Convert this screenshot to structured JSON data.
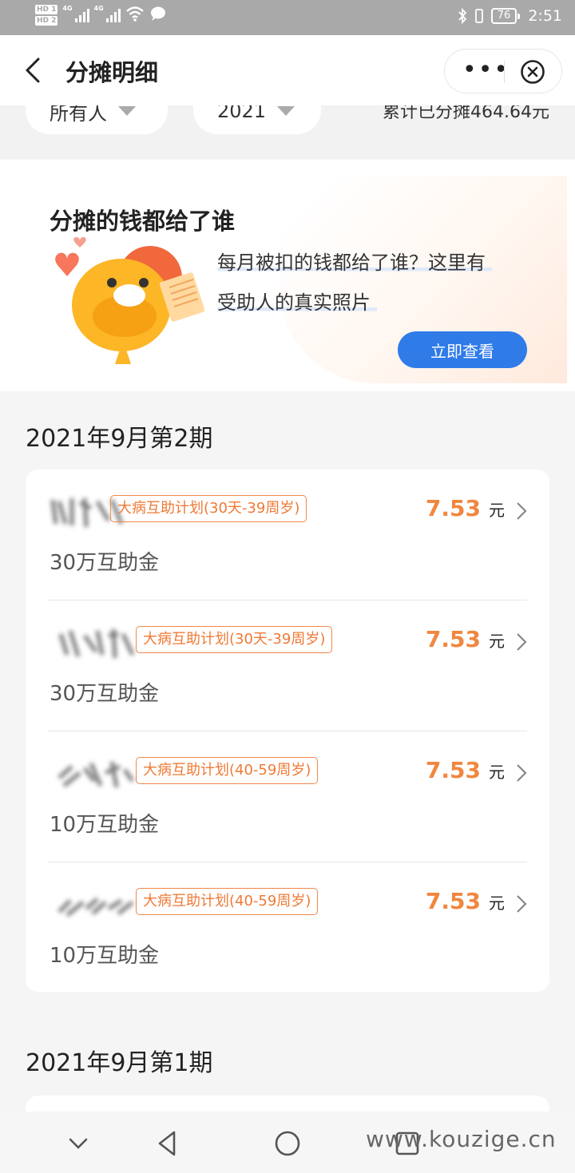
{
  "status_bar": {
    "hd1": "HD 1",
    "hd2": "HD 2",
    "net1": "4G",
    "net2": "4G",
    "battery": "76",
    "time": "2:51"
  },
  "header": {
    "title": "分摊明细",
    "more_label": "•••"
  },
  "filters": {
    "person": "所有人",
    "year": "2021",
    "total": "累计已分摊464.64元"
  },
  "banner": {
    "title": "分摊的钱都给了谁",
    "line1": "每月被扣的钱都给了谁？这里有",
    "line2": "受助人的真实照片",
    "button": "立即查看"
  },
  "periods": [
    {
      "title": "2021年9月第2期",
      "items": [
        {
          "plan": "大病互助计划(30天-39周岁)",
          "amount": "7.53",
          "unit": "元",
          "sub": "30万互助金"
        },
        {
          "plan": "大病互助计划(30天-39周岁)",
          "amount": "7.53",
          "unit": "元",
          "sub": "30万互助金"
        },
        {
          "plan": "大病互助计划(40-59周岁)",
          "amount": "7.53",
          "unit": "元",
          "sub": "10万互助金"
        },
        {
          "plan": "大病互助计划(40-59周岁)",
          "amount": "7.53",
          "unit": "元",
          "sub": "10万互助金"
        }
      ]
    },
    {
      "title": "2021年9月第1期"
    }
  ],
  "navbar": {
    "watermark": "www.kouzige.cn"
  },
  "colors": {
    "accent_orange": "#f0873f",
    "button_blue": "#2f7be8",
    "statusbar_gray": "#a9a9a9"
  },
  "icons": [
    "back-arrow-icon",
    "more-icon",
    "close-circle-icon",
    "dropdown-triangle-icon",
    "chevron-right-icon",
    "mascot-illustration",
    "nav-down-icon",
    "nav-back-icon",
    "nav-home-icon",
    "nav-recent-icon"
  ]
}
